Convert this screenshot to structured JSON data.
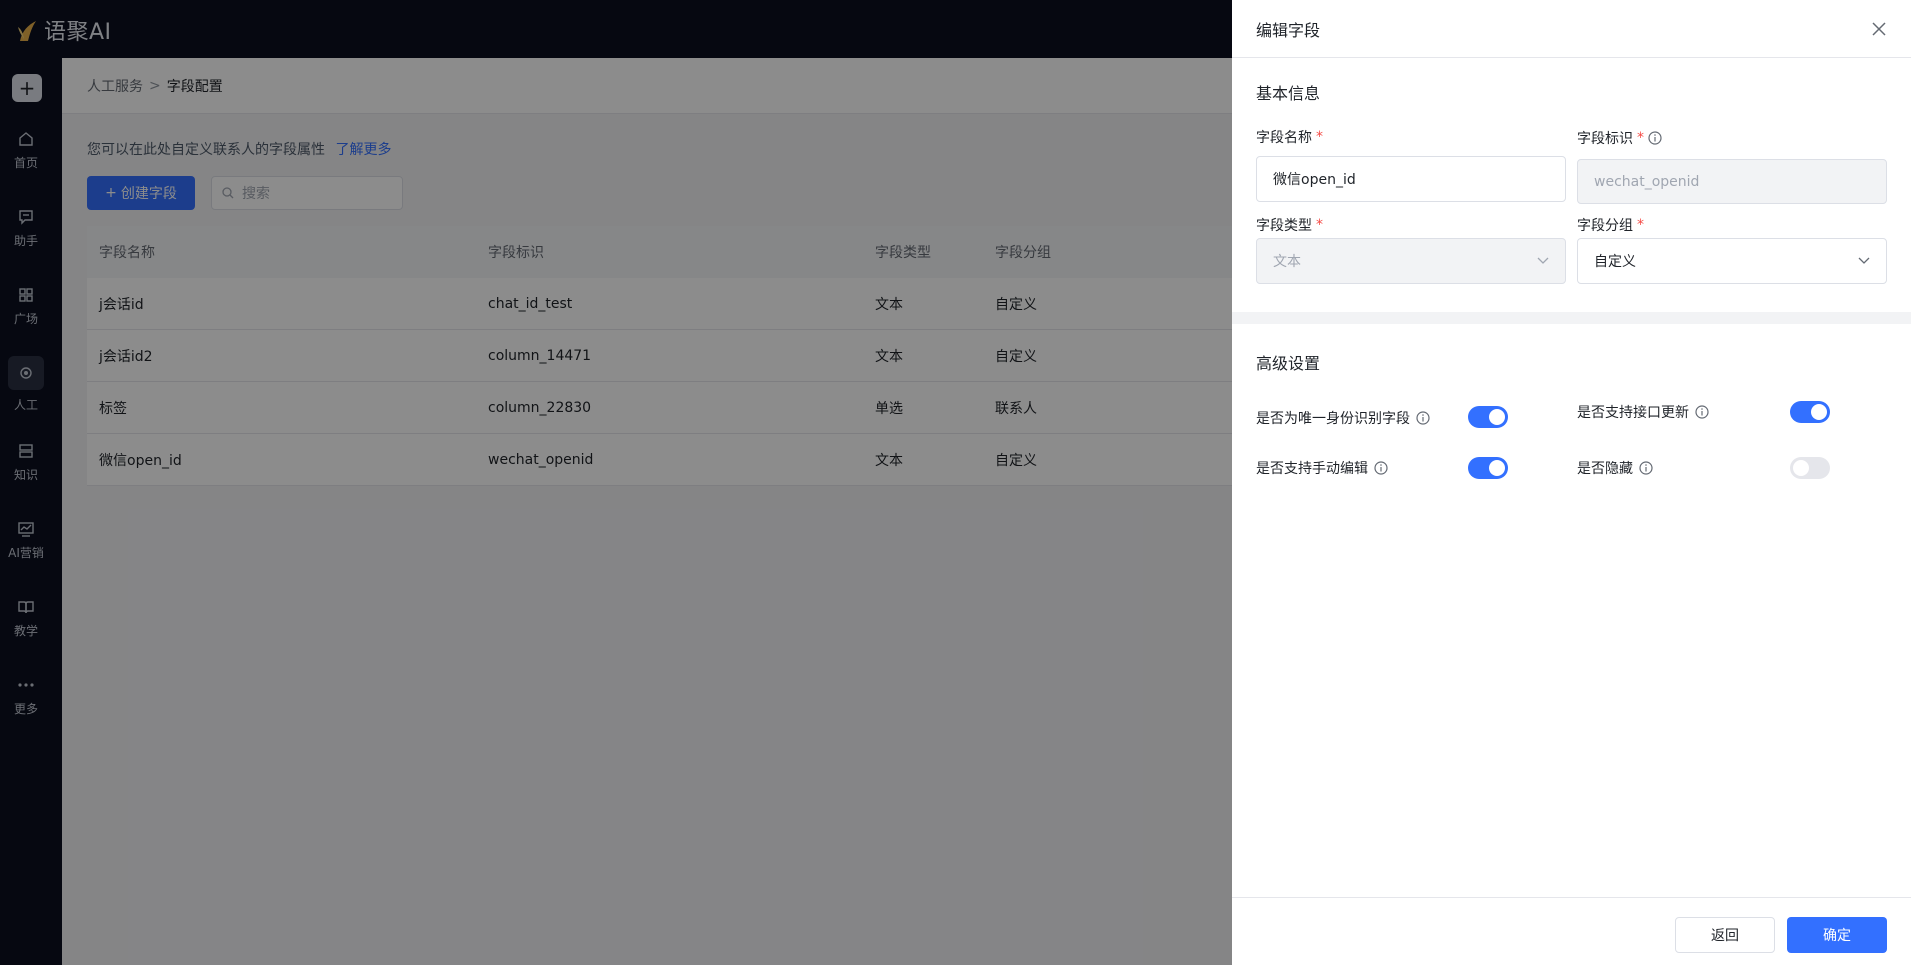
{
  "app": {
    "logo_text": "语聚AI"
  },
  "sidebar": {
    "add_label": "+",
    "items": [
      {
        "label": "首页",
        "icon": "home-icon"
      },
      {
        "label": "助手",
        "icon": "chat-icon"
      },
      {
        "label": "广场",
        "icon": "grid-icon"
      },
      {
        "label": "人工",
        "icon": "headset-icon"
      },
      {
        "label": "知识",
        "icon": "database-icon"
      },
      {
        "label": "AI营销",
        "icon": "chart-icon"
      },
      {
        "label": "教学",
        "icon": "book-icon"
      },
      {
        "label": "更多",
        "icon": "more-icon"
      }
    ]
  },
  "breadcrumb": {
    "parent": "人工服务",
    "separator": ">",
    "current": "字段配置"
  },
  "main": {
    "description": "您可以在此处自定义联系人的字段属性",
    "learn_more": "了解更多",
    "create_button": "创建字段",
    "search_placeholder": "搜索"
  },
  "table": {
    "headers": [
      "字段名称",
      "字段标识",
      "字段类型",
      "字段分组"
    ],
    "rows": [
      [
        "j会话id",
        "chat_id_test",
        "文本",
        "自定义"
      ],
      [
        "j会话id2",
        "column_14471",
        "文本",
        "自定义"
      ],
      [
        "标签",
        "column_22830",
        "单选",
        "联系人"
      ],
      [
        "微信open_id",
        "wechat_openid",
        "文本",
        "自定义"
      ]
    ]
  },
  "drawer": {
    "title": "编辑字段",
    "basic_section": "基本信息",
    "field_name_label": "字段名称",
    "field_name_value": "微信open_id",
    "field_key_label": "字段标识",
    "field_key_value": "wechat_openid",
    "field_type_label": "字段类型",
    "field_type_value": "文本",
    "field_group_label": "字段分组",
    "field_group_value": "自定义",
    "required_mark": "*",
    "advanced_section": "高级设置",
    "toggles": {
      "unique_label": "是否为唯一身份识别字段",
      "unique_on": true,
      "api_update_label": "是否支持接口更新",
      "api_update_on": true,
      "manual_edit_label": "是否支持手动编辑",
      "manual_edit_on": true,
      "hidden_label": "是否隐藏",
      "hidden_on": false
    },
    "back_button": "返回",
    "confirm_button": "确定"
  },
  "colors": {
    "accent": "#3370ff",
    "sidebar_bg": "#0b0f1f",
    "required": "#f54a45"
  }
}
